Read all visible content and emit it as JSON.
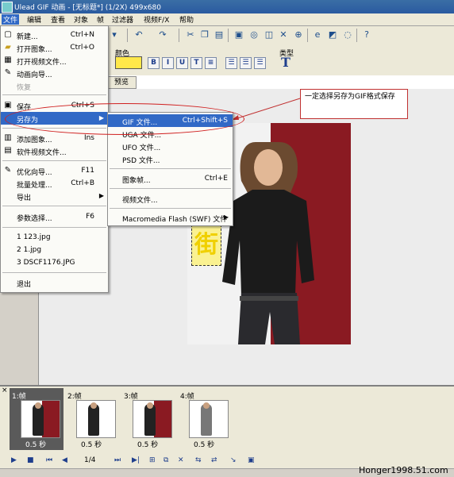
{
  "window": {
    "title": "Ulead GIF 动画 - [无标题*] (1/2X)  499x680"
  },
  "menubar": [
    "文件",
    "编辑",
    "查看",
    "对象",
    "帧",
    "过滤器",
    "视频F/X",
    "帮助"
  ],
  "properties": {
    "color_label": "颜色",
    "type_label": "类型",
    "color_value": "#ffe84a"
  },
  "tabs": {
    "preview": "预览"
  },
  "file_menu": [
    {
      "label": "新建...",
      "shortcut": "Ctrl+N",
      "icon": "new-file-icon"
    },
    {
      "label": "打开图象...",
      "shortcut": "Ctrl+O",
      "icon": "open-folder-icon"
    },
    {
      "label": "打开视频文件...",
      "shortcut": "",
      "icon": "video-file-icon"
    },
    {
      "label": "动画向导...",
      "shortcut": "",
      "icon": "wizard-icon"
    },
    {
      "label": "恢复",
      "shortcut": "",
      "icon": "",
      "disabled": true
    },
    {
      "label": "保存",
      "shortcut": "Ctrl+S",
      "icon": "save-icon"
    },
    {
      "label": "另存为",
      "shortcut": "",
      "icon": "",
      "submenu": true
    },
    {
      "label": "添加图象...",
      "shortcut": "Ins",
      "icon": "add-image-icon"
    },
    {
      "label": "软件视频文件...",
      "shortcut": "",
      "icon": "software-video-icon"
    },
    {
      "label": "优化向导...",
      "shortcut": "F11",
      "icon": "optimize-wizard-icon"
    },
    {
      "label": "批量处理...",
      "shortcut": "Ctrl+B",
      "icon": ""
    },
    {
      "label": "导出",
      "shortcut": "",
      "icon": "",
      "submenu": true
    },
    {
      "label": "参数选择...",
      "shortcut": "F6",
      "icon": ""
    },
    {
      "label": "1 123.jpg",
      "shortcut": "",
      "icon": ""
    },
    {
      "label": "2 1.jpg",
      "shortcut": "",
      "icon": ""
    },
    {
      "label": "3 DSCF1176.JPG",
      "shortcut": "",
      "icon": ""
    },
    {
      "label": "退出",
      "shortcut": "",
      "icon": ""
    }
  ],
  "save_as_menu": [
    {
      "label": "GIF 文件...",
      "shortcut": "Ctrl+Shift+S"
    },
    {
      "label": "UGA 文件...",
      "shortcut": ""
    },
    {
      "label": "UFO 文件...",
      "shortcut": ""
    },
    {
      "label": "PSD 文件...",
      "shortcut": ""
    },
    {
      "label": "图象帧...",
      "shortcut": "Ctrl+E"
    },
    {
      "label": "视频文件...",
      "shortcut": ""
    },
    {
      "label": "Macromedia Flash (SWF) 文件",
      "shortcut": ""
    }
  ],
  "callout": "一定选择另存为GIF格式保存",
  "overlay_char": "街",
  "frames": [
    {
      "label": "1:帧",
      "delay": "0.5 秒"
    },
    {
      "label": "2:帧",
      "delay": "0.5 秒"
    },
    {
      "label": "3:帧",
      "delay": "0.5 秒"
    },
    {
      "label": "4:帧",
      "delay": "0.5 秒"
    }
  ],
  "playbar": {
    "frame_counter": "1/4"
  },
  "watermark": "Honger1998.51.com"
}
